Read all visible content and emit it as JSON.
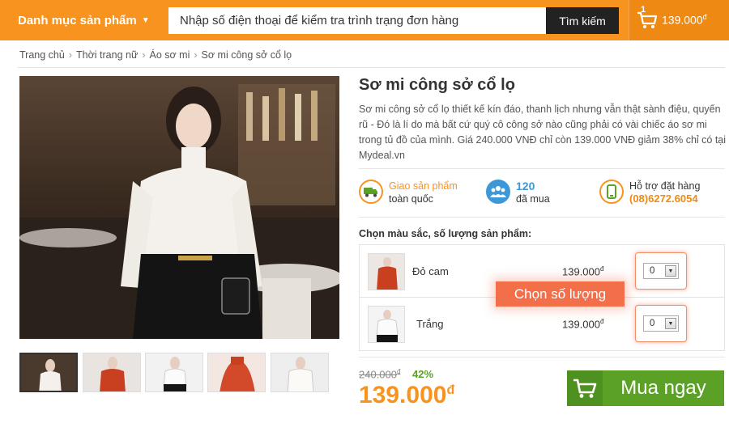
{
  "header": {
    "category_menu": "Danh mục sản phẩm",
    "search_placeholder": "Nhập số điện thoại để kiểm tra trình trạng đơn hàng",
    "search_button": "Tìm kiếm",
    "cart_count": "1",
    "cart_total": "139.000",
    "currency": "đ"
  },
  "breadcrumb": [
    "Trang chủ",
    "Thời trang nữ",
    "Áo sơ mi",
    "Sơ mi công sở cổ lọ"
  ],
  "breadcrumb_sep": "›",
  "product": {
    "title": "Sơ mi công sở cổ lọ",
    "description": "Sơ mi công sở cổ lọ thiết kế kín đáo, thanh lịch nhưng vẫn thật sành điệu, quyến rũ - Đó là lí do mà bất cứ quý cô công sở nào cũng phải có vài chiếc áo sơ mi trong tủ đồ của mình. Giá 240.000 VNĐ chỉ còn 139.000 VNĐ giảm 38% chỉ có tại Mydeal.vn"
  },
  "features": {
    "delivery": {
      "line1": "Giao sản phẩm",
      "line2": "toàn quốc",
      "icon": "truck-icon"
    },
    "bought": {
      "count": "120",
      "label": "đã mua",
      "icon": "people-icon"
    },
    "support": {
      "label": "Hỗ trợ đặt hàng",
      "phone": "(08)6272.6054",
      "icon": "phone-icon"
    }
  },
  "variants_label": "Chọn màu sắc, số lượng sản phẩm:",
  "variants": [
    {
      "name": "Đỏ cam",
      "price": "139.000",
      "qty": "0",
      "color": "#c8401f"
    },
    {
      "name": "Trắng",
      "price": "139.000",
      "qty": "0",
      "color": "#f1eeea"
    }
  ],
  "tooltip": "Chọn số lượng",
  "pricing": {
    "old_price": "240.000",
    "discount": "42%",
    "new_price": "139.000",
    "currency": "đ"
  },
  "buy_button": "Mua ngay",
  "colors": {
    "accent_orange": "#f7931e",
    "buy_green": "#5aa126",
    "tooltip": "#f36f4a",
    "info_blue": "#3d98d8"
  }
}
